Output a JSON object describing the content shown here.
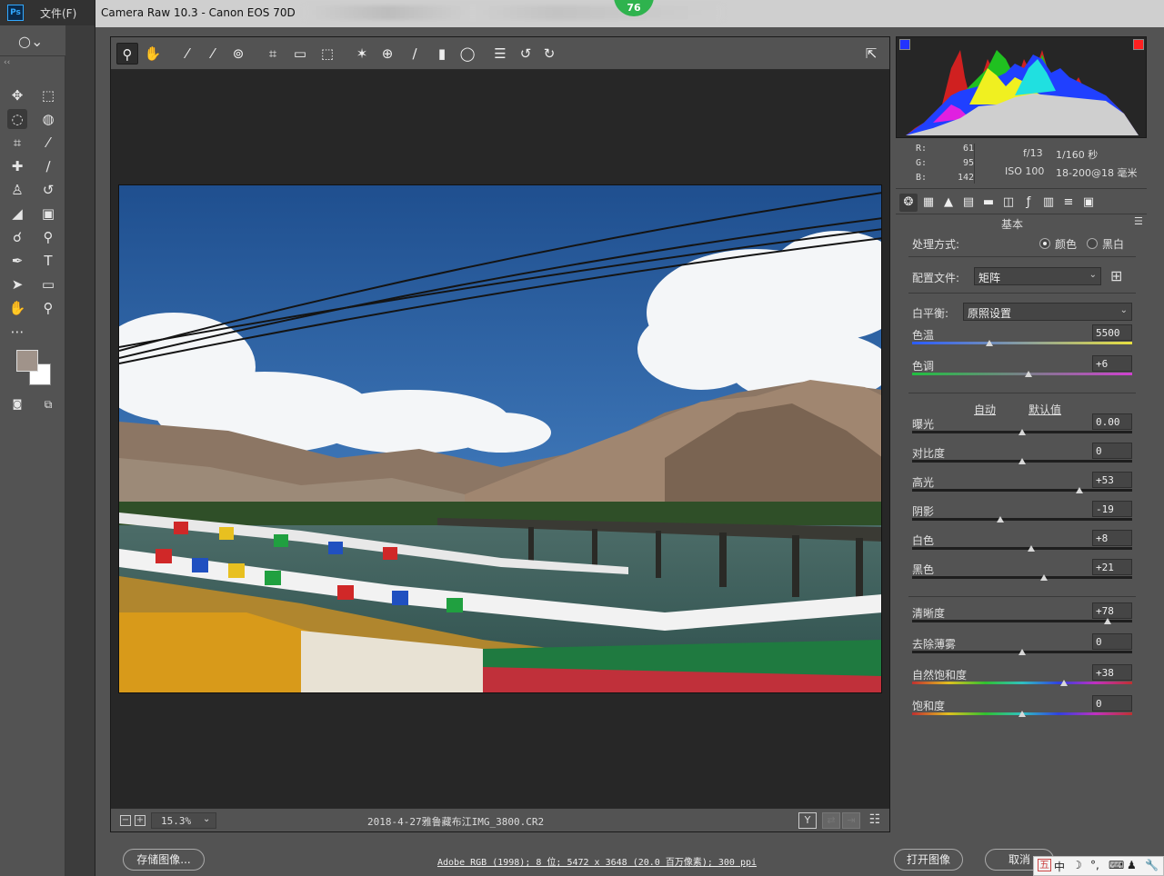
{
  "photoshop": {
    "menu_file": "文件(F)",
    "logo": "Ps",
    "collapse": "‹‹"
  },
  "window": {
    "title": "Camera Raw 10.3 -  Canon EOS 70D",
    "badge": "76"
  },
  "preview": {
    "zoom": "15.3%",
    "filename": "2018-4-27雅鲁藏布江IMG_3800.CR2",
    "view_toggle_label": "Y"
  },
  "histogram": {
    "colors": {
      "shadow_clip": "#2233ff",
      "highlight_clip": "#ff2020"
    }
  },
  "info": {
    "r_label": "R:",
    "r_value": "61",
    "g_label": "G:",
    "g_value": "95",
    "b_label": "B:",
    "b_value": "142",
    "aperture": "f/13",
    "shutter": "1/160 秒",
    "iso": "ISO 100",
    "lens": "18-200@18 毫米"
  },
  "basic": {
    "title": "基本",
    "treatment_label": "处理方式:",
    "treatment_color": "颜色",
    "treatment_bw": "黑白",
    "treatment_selected": "颜色",
    "profile_label": "配置文件:",
    "profile_value": "矩阵",
    "wb_label": "白平衡:",
    "wb_value": "原照设置",
    "auto_label": "自动",
    "default_label": "默认值",
    "sliders": [
      {
        "label": "色温",
        "value": "5500",
        "position": 0.35
      },
      {
        "label": "色调",
        "value": "+6",
        "position": 0.53
      },
      {
        "label": "曝光",
        "value": "0.00",
        "position": 0.5
      },
      {
        "label": "对比度",
        "value": "0",
        "position": 0.5
      },
      {
        "label": "高光",
        "value": "+53",
        "position": 0.76
      },
      {
        "label": "阴影",
        "value": "-19",
        "position": 0.4
      },
      {
        "label": "白色",
        "value": "+8",
        "position": 0.54
      },
      {
        "label": "黑色",
        "value": "+21",
        "position": 0.6
      },
      {
        "label": "清晰度",
        "value": "+78",
        "position": 0.89
      },
      {
        "label": "去除薄雾",
        "value": "0",
        "position": 0.5
      },
      {
        "label": "自然饱和度",
        "value": "+38",
        "position": 0.69
      },
      {
        "label": "饱和度",
        "value": "0",
        "position": 0.5
      }
    ]
  },
  "bottom": {
    "save_button": "存储图像...",
    "workflow_link": "Adobe RGB (1998); 8 位; 5472 x 3648 (20.0 百万像素); 300 ppi",
    "open_button": "打开图像",
    "cancel_button": "取消"
  },
  "ime": {
    "mode": "中",
    "items": [
      "☽",
      "°,",
      "⌨",
      "♟",
      "🔧"
    ]
  }
}
